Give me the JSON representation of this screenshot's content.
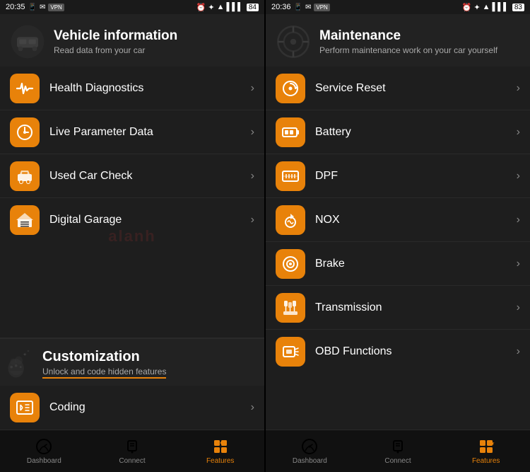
{
  "left_phone": {
    "status": {
      "left": "20:35",
      "battery": "84"
    },
    "section1": {
      "title": "Vehicle information",
      "subtitle": "Read data from your car"
    },
    "menu1": [
      {
        "id": "health",
        "label": "Health Diagnostics"
      },
      {
        "id": "live",
        "label": "Live Parameter Data"
      },
      {
        "id": "usedcar",
        "label": "Used Car Check"
      },
      {
        "id": "garage",
        "label": "Digital Garage"
      }
    ],
    "section2": {
      "title": "Customization",
      "subtitle": "Unlock and code hidden features"
    },
    "menu2": [
      {
        "id": "coding",
        "label": "Coding"
      }
    ],
    "nav": [
      {
        "id": "dashboard",
        "label": "Dashboard",
        "active": false
      },
      {
        "id": "connect",
        "label": "Connect",
        "active": false
      },
      {
        "id": "features",
        "label": "Features",
        "active": true
      }
    ]
  },
  "right_phone": {
    "status": {
      "left": "20:36",
      "battery": "83"
    },
    "section1": {
      "title": "Maintenance",
      "subtitle": "Perform maintenance work on your car yourself"
    },
    "menu": [
      {
        "id": "service",
        "label": "Service Reset"
      },
      {
        "id": "battery",
        "label": "Battery"
      },
      {
        "id": "dpf",
        "label": "DPF"
      },
      {
        "id": "nox",
        "label": "NOX"
      },
      {
        "id": "brake",
        "label": "Brake"
      },
      {
        "id": "transmission",
        "label": "Transmission"
      },
      {
        "id": "obd",
        "label": "OBD Functions"
      }
    ],
    "nav": [
      {
        "id": "dashboard",
        "label": "Dashboard",
        "active": false
      },
      {
        "id": "connect",
        "label": "Connect",
        "active": false
      },
      {
        "id": "features",
        "label": "Features",
        "active": true
      }
    ]
  },
  "watermark": "alanh"
}
